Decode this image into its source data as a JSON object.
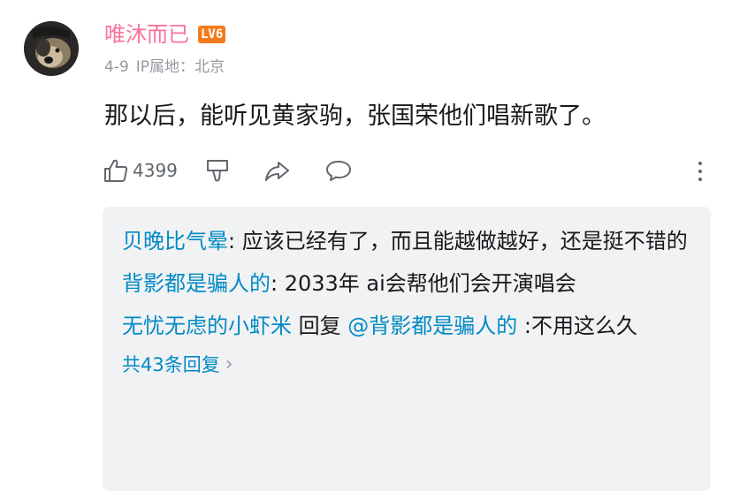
{
  "comment": {
    "username": "唯沐而已",
    "level_badge": "LV6",
    "date": "4-9",
    "ip_location": "IP属地：北京",
    "text": "那以后，能听见黄家驹，张国荣他们唱新歌了。",
    "like_count": "4399"
  },
  "colors": {
    "username": "#fb7299",
    "level_badge": "#f37b1d",
    "reply_user": "#008ac5",
    "reply_panel_bg": "#f1f2f3",
    "meta_text": "#9499a0"
  },
  "icons": {
    "like": "thumbs-up-icon",
    "dislike": "thumbs-down-icon",
    "share": "share-icon",
    "reply": "comment-icon",
    "more": "more-vertical-icon"
  },
  "replies": [
    {
      "user": "贝晚比气晕",
      "sep": ": ",
      "text": "应该已经有了，而且能越做越好，还是挺不错的"
    },
    {
      "user": "背影都是骗人的",
      "sep": ": ",
      "text": "2033年  ai会帮他们会开演唱会"
    },
    {
      "user": "无忧无虑的小虾米",
      "reply_word": " 回复 ",
      "mention": "@背影都是骗人的",
      "sep": " :",
      "text": "不用这么久"
    }
  ],
  "replies_total": "共43条回复"
}
